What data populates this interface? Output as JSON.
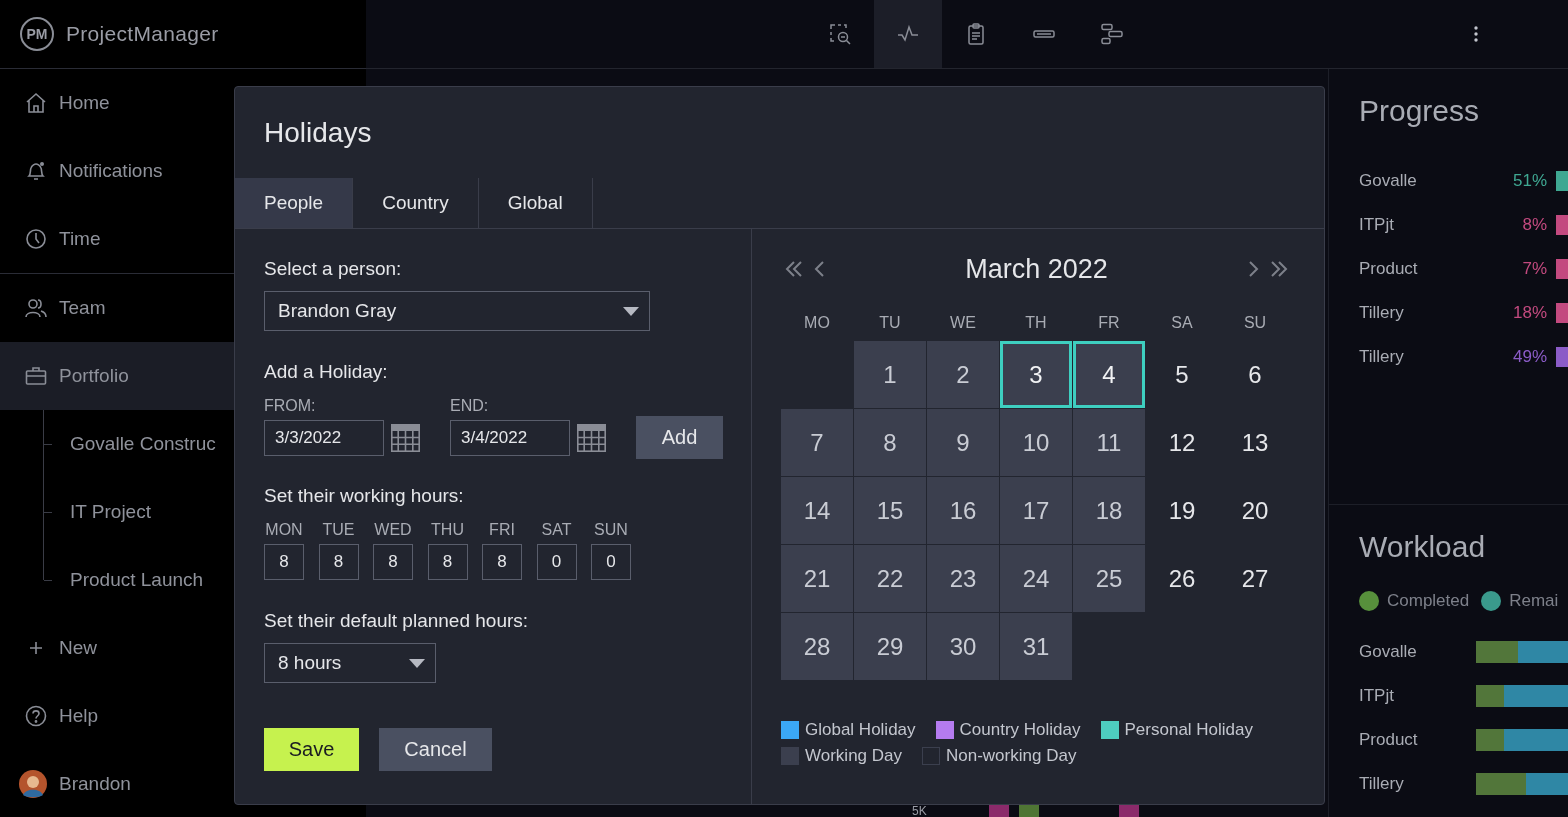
{
  "app": {
    "logo_text": "PM",
    "name": "ProjectManager"
  },
  "toolbar": {
    "tools": [
      {
        "kind": "zoom",
        "selected": false
      },
      {
        "kind": "pulse",
        "selected": true
      },
      {
        "kind": "clipboard",
        "selected": false
      },
      {
        "kind": "bar",
        "selected": false
      },
      {
        "kind": "gantt",
        "selected": false
      }
    ]
  },
  "sidebar": {
    "sections": [
      {
        "items": [
          {
            "kind": "home",
            "label": "Home",
            "selected": false
          },
          {
            "kind": "bell",
            "label": "Notifications",
            "selected": false
          },
          {
            "kind": "clock",
            "label": "Time",
            "selected": false
          }
        ]
      },
      {
        "items": [
          {
            "kind": "team",
            "label": "Team",
            "selected": false
          },
          {
            "kind": "briefcase",
            "label": "Portfolio",
            "selected": true,
            "children": [
              {
                "label": "Govalle Construc",
                "selected": false
              },
              {
                "label": "IT Project",
                "selected": false
              },
              {
                "label": "Product Launch",
                "selected": false
              }
            ]
          },
          {
            "kind": "plus",
            "label": "New",
            "selected": false
          },
          {
            "kind": "help",
            "label": "Help",
            "selected": false
          },
          {
            "kind": "avatar",
            "label": "Brandon",
            "selected": false
          }
        ]
      }
    ]
  },
  "background_chart": {
    "axis_label": "5K"
  },
  "right_panel": {
    "progress": {
      "title": "Progress",
      "rows": [
        {
          "name": "Govalle",
          "percent": "51%",
          "color": "#3fa892"
        },
        {
          "name": "ITPjt",
          "percent": "8%",
          "color": "#c34a7f"
        },
        {
          "name": "Product",
          "percent": "7%",
          "color": "#c34a7f"
        },
        {
          "name": "Tillery",
          "percent": "18%",
          "color": "#c34a7f"
        },
        {
          "name": "Tillery",
          "percent": "49%",
          "color": "#8b5cc7"
        }
      ]
    },
    "workload": {
      "title": "Workload",
      "legend": [
        {
          "label": "Completed",
          "color": "#57903c"
        },
        {
          "label": "Remai",
          "color": "#3a9a8c"
        }
      ],
      "rows": [
        {
          "name": "Govalle",
          "level": 0.45
        },
        {
          "name": "ITPjt",
          "level": 0.3
        },
        {
          "name": "Product",
          "level": 0.3
        },
        {
          "name": "Tillery",
          "level": 0.54
        }
      ]
    }
  },
  "modal": {
    "title": "Holidays",
    "tabs": [
      {
        "label": "People",
        "selected": true
      },
      {
        "label": "Country",
        "selected": false
      },
      {
        "label": "Global",
        "selected": false
      }
    ],
    "person": {
      "label": "Select a person:",
      "value": "Brandon Gray"
    },
    "add_holiday": {
      "label": "Add a Holiday:",
      "from": {
        "label": "FROM:",
        "value": "3/3/2022"
      },
      "end": {
        "label": "END:",
        "value": "3/4/2022"
      },
      "button": "Add"
    },
    "working_hours": {
      "label": "Set their working hours:",
      "days": [
        {
          "day": "MON",
          "hours": "8"
        },
        {
          "day": "TUE",
          "hours": "8"
        },
        {
          "day": "WED",
          "hours": "8"
        },
        {
          "day": "THU",
          "hours": "8"
        },
        {
          "day": "FRI",
          "hours": "8"
        },
        {
          "day": "SAT",
          "hours": "0"
        },
        {
          "day": "SUN",
          "hours": "0"
        }
      ]
    },
    "planned_hours": {
      "label": "Set their default planned hours:",
      "value": "8 hours"
    },
    "buttons": [
      {
        "label": "Save",
        "kind": "primary"
      },
      {
        "label": "Cancel",
        "kind": "secondary"
      }
    ],
    "calendar": {
      "title": "March 2022",
      "weekdays": [
        "MO",
        "TU",
        "WE",
        "TH",
        "FR",
        "SA",
        "SU"
      ],
      "weeks": [
        [
          {
            "kind": "empty"
          },
          {
            "day": "1",
            "kind": "working"
          },
          {
            "day": "2",
            "kind": "working"
          },
          {
            "day": "3",
            "kind": "personal"
          },
          {
            "day": "4",
            "kind": "personal"
          },
          {
            "day": "5",
            "kind": "nonworking"
          },
          {
            "day": "6",
            "kind": "nonworking"
          }
        ],
        [
          {
            "day": "7",
            "kind": "working"
          },
          {
            "day": "8",
            "kind": "working"
          },
          {
            "day": "9",
            "kind": "working"
          },
          {
            "day": "10",
            "kind": "working"
          },
          {
            "day": "11",
            "kind": "working"
          },
          {
            "day": "12",
            "kind": "nonworking"
          },
          {
            "day": "13",
            "kind": "nonworking"
          }
        ],
        [
          {
            "day": "14",
            "kind": "working"
          },
          {
            "day": "15",
            "kind": "working"
          },
          {
            "day": "16",
            "kind": "working"
          },
          {
            "day": "17",
            "kind": "working"
          },
          {
            "day": "18",
            "kind": "working"
          },
          {
            "day": "19",
            "kind": "nonworking"
          },
          {
            "day": "20",
            "kind": "nonworking"
          }
        ],
        [
          {
            "day": "21",
            "kind": "working"
          },
          {
            "day": "22",
            "kind": "working"
          },
          {
            "day": "23",
            "kind": "working"
          },
          {
            "day": "24",
            "kind": "working"
          },
          {
            "day": "25",
            "kind": "working"
          },
          {
            "day": "26",
            "kind": "nonworking"
          },
          {
            "day": "27",
            "kind": "nonworking"
          }
        ],
        [
          {
            "day": "28",
            "kind": "working"
          },
          {
            "day": "29",
            "kind": "working"
          },
          {
            "day": "30",
            "kind": "working"
          },
          {
            "day": "31",
            "kind": "working"
          },
          {
            "kind": "empty"
          },
          {
            "kind": "empty"
          },
          {
            "kind": "empty"
          }
        ]
      ],
      "legend": [
        {
          "label": "Global Holiday",
          "kind": "filled",
          "color": "#3ba7f5"
        },
        {
          "label": "Country Holiday",
          "kind": "filled",
          "color": "#b57bf0"
        },
        {
          "label": "Personal Holiday",
          "kind": "filled",
          "color": "#4ecdc0"
        },
        {
          "label": "Working Day",
          "kind": "filled",
          "color": "#3b3f4e"
        },
        {
          "label": "Non-working Day",
          "kind": "outline",
          "color": "#3b3f4e"
        }
      ]
    }
  }
}
